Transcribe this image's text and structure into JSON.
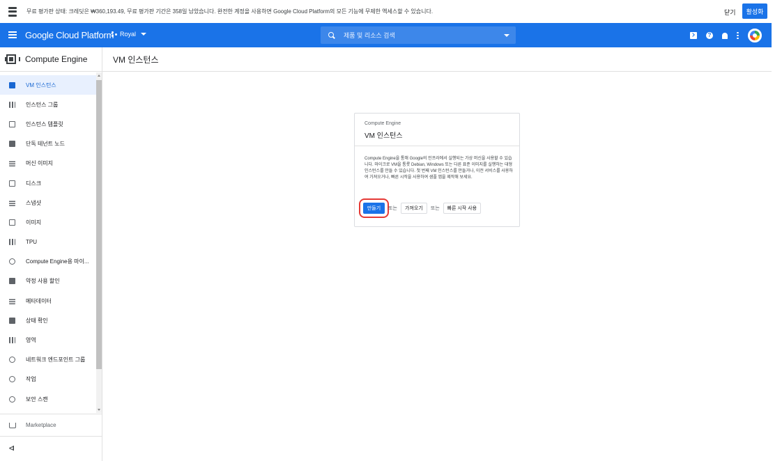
{
  "trial_banner": {
    "text": "무료 평가판 상태: 크레딧은 ₩360,193.49, 무료 평가판 기간은 358일 남았습니다. 완전한 계정을 사용하면 Google Cloud Platform의 모든 기능에 무제한 액세스할 수 있습니다.",
    "close_label": "닫기",
    "activate_label": "활성화"
  },
  "header": {
    "brand": "Google Cloud Platform",
    "project": "Royal",
    "search_placeholder": "제품 및 리소스 검색",
    "icons": [
      "cloud-shell-icon",
      "help-icon",
      "notifications-icon",
      "more-vert-icon",
      "account-avatar"
    ]
  },
  "sidebar": {
    "product_title": "Compute Engine",
    "items": [
      {
        "label": "VM 인스턴스",
        "icon": "vm-instance-icon",
        "active": true
      },
      {
        "label": "인스턴스 그룹",
        "icon": "instance-group-icon"
      },
      {
        "label": "인스턴스 템플릿",
        "icon": "instance-template-icon"
      },
      {
        "label": "단독 테넌트 노드",
        "icon": "sole-tenant-icon"
      },
      {
        "label": "머신 이미지",
        "icon": "machine-image-icon"
      },
      {
        "label": "디스크",
        "icon": "disk-icon"
      },
      {
        "label": "스냅샷",
        "icon": "snapshot-icon"
      },
      {
        "label": "이미지",
        "icon": "image-icon"
      },
      {
        "label": "TPU",
        "icon": "tpu-icon"
      },
      {
        "label": "Compute Engine용 마이...",
        "icon": "migrate-icon"
      },
      {
        "label": "약정 사용 할인",
        "icon": "committed-use-icon"
      },
      {
        "label": "메타데이터",
        "icon": "metadata-icon"
      },
      {
        "label": "상태 확인",
        "icon": "health-check-icon"
      },
      {
        "label": "영역",
        "icon": "zones-icon"
      },
      {
        "label": "네트워크 엔드포인트 그룹",
        "icon": "network-endpoint-icon"
      },
      {
        "label": "작업",
        "icon": "operations-icon"
      },
      {
        "label": "보안 스캔",
        "icon": "security-scan-icon"
      }
    ],
    "marketplace_label": "Marketplace",
    "collapse_icon": "<I"
  },
  "main": {
    "page_title": "VM 인스턴스"
  },
  "card": {
    "eyebrow": "Compute Engine",
    "title": "VM 인스턴스",
    "body": "Compute Engine을 통해 Google의 인프라에서 실행되는 가상 머신을 사용할 수 있습니다. 마이크로 VM을 통롯 Debian, Windows 또는 다른 표준 이미지를 실행하는 대형 인스턴스를 만들 수 있습니다. 첫 번째 VM 인스턴스를 만들거나, 이전 서비스를 사용하여 가져오거나, 빠른 시작을 사용하여 샘플 앱을 제작해 보세요.",
    "create_label": "만들기",
    "or1": "또는",
    "import_label": "가져오기",
    "or2": "또는",
    "quickstart_label": "빠른 시작 사용"
  },
  "colors": {
    "brand_blue": "#1a73e8",
    "highlight_red": "#e53935",
    "active_bg": "#e8f0fe"
  }
}
